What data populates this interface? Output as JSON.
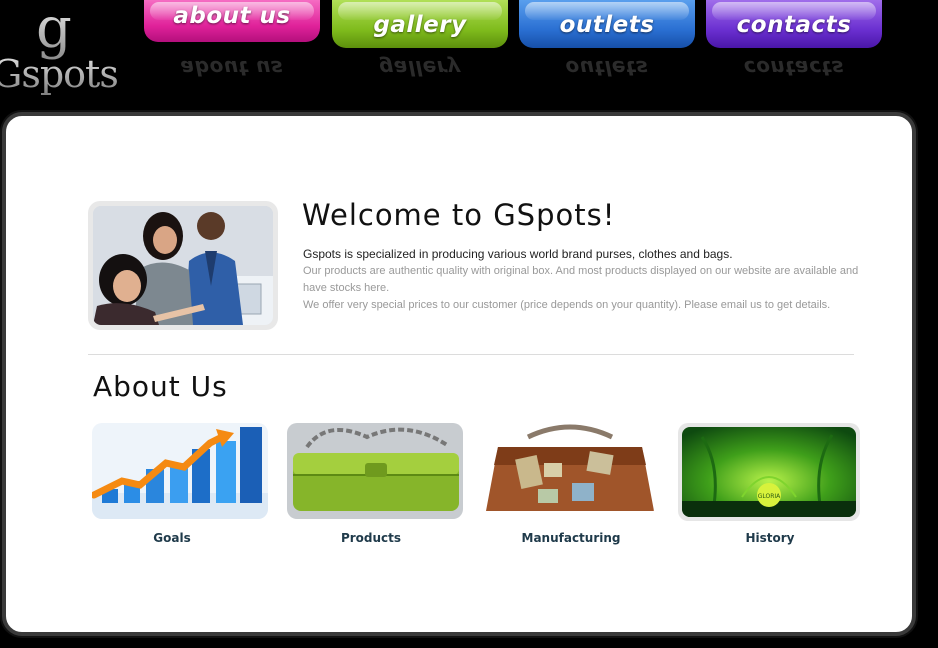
{
  "logo": {
    "letter": "g",
    "word": "Gspots"
  },
  "nav": [
    {
      "label": "about us",
      "color_top": "#ff7fd0",
      "color_bottom": "#d9158f"
    },
    {
      "label": "gallery",
      "color_top": "#b9e85a",
      "color_bottom": "#6fa914"
    },
    {
      "label": "outlets",
      "color_top": "#5fa8f5",
      "color_bottom": "#1b5fc4"
    },
    {
      "label": "contacts",
      "color_top": "#a56ff0",
      "color_bottom": "#5a1fc0"
    }
  ],
  "welcome": {
    "title": "Welcome to GSpots!",
    "lead": "Gspots is specialized in producing various world brand purses, clothes and bags.",
    "line2": "Our products are authentic quality with original box. And most products displayed on our website are available and have stocks here.",
    "line3": "We offer very special prices to our customer (price depends on your quantity). Please email us to get details."
  },
  "about": {
    "title": "About Us",
    "items": [
      {
        "label": "Goals"
      },
      {
        "label": "Products"
      },
      {
        "label": "Manufacturing"
      },
      {
        "label": "History"
      }
    ]
  },
  "history_badge": "GLORIA"
}
